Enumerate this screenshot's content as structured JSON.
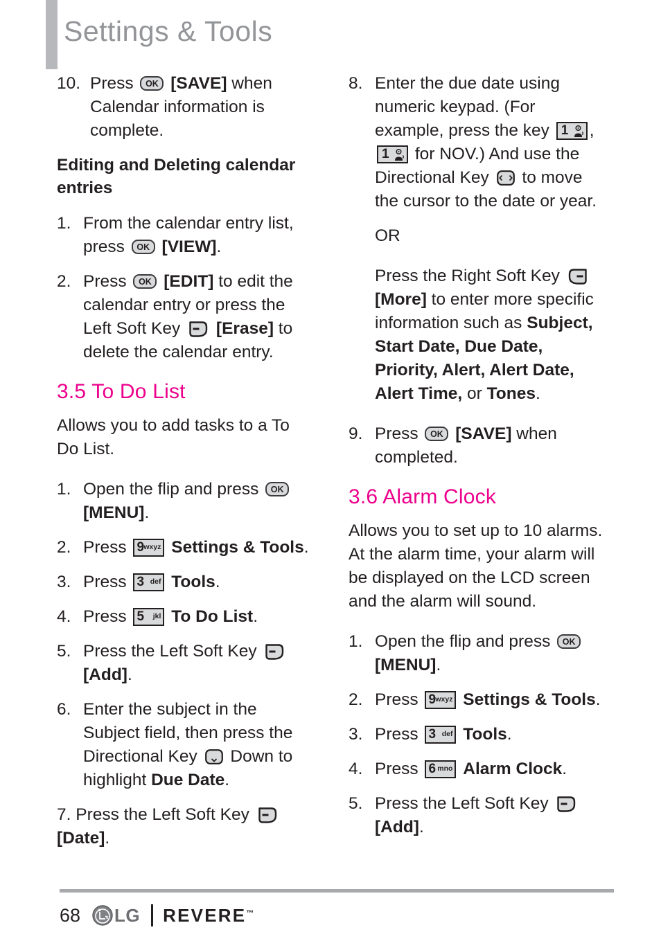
{
  "header": {
    "title": "Settings & Tools"
  },
  "left_column": {
    "step10": {
      "num": "10.",
      "t1": "Press",
      "icon": "ok-key-icon",
      "t2": "[SAVE]",
      "t3": "when Calendar information is complete."
    },
    "subhead_editing": "Editing and Deleting calendar entries",
    "step1": {
      "num": "1.",
      "t1": "From the calendar entry list, press",
      "icon": "ok-key-icon",
      "t2": "[VIEW]",
      "t3": "."
    },
    "step2": {
      "num": "2.",
      "t1": "Press",
      "icon1": "ok-key-icon",
      "t2": "[EDIT]",
      "t3": "to edit the calendar entry or press the Left Soft Key",
      "icon2": "left-soft-key-icon",
      "t4": "[Erase]",
      "t5": "to delete the calendar entry."
    },
    "section_35": "3.5 To Do List",
    "intro_35": "Allows you to add tasks to a To Do List.",
    "steps": [
      {
        "num": "1.",
        "t1": "Open the flip and press",
        "icon": "ok-key-icon",
        "t2": "[MENU]",
        "t3": "."
      },
      {
        "num": "2.",
        "t1": "Press",
        "key_digit": "9",
        "key_letters": "wxyz",
        "t2": "Settings & Tools",
        "t3": "."
      },
      {
        "num": "3.",
        "t1": "Press",
        "key_digit": "3",
        "key_letters": "def",
        "t2": "Tools",
        "t3": "."
      },
      {
        "num": "4.",
        "t1": "Press",
        "key_digit": "5",
        "key_letters": "jkl",
        "t2": "To Do List",
        "t3": "."
      },
      {
        "num": "5.",
        "t1": "Press the Left Soft Key",
        "icon": "left-soft-key-icon",
        "t2": "[Add]",
        "t3": "."
      },
      {
        "num": "6.",
        "t1": "Enter the subject in the Subject field, then press the Directional Key",
        "icon": "directional-key-down-icon",
        "t2": "Down to highlight",
        "t3": "Due Date",
        "t4": "."
      },
      {
        "num": "7.",
        "t1": "Press the Left Soft Key",
        "icon": "left-soft-key-icon",
        "t2": "[Date]",
        "t3": "."
      }
    ]
  },
  "right_column": {
    "step8": {
      "num": "8.",
      "t1": "Enter the due date using numeric keypad. (For example, press the key",
      "key1_digit": "1",
      "sep": ",",
      "key2_digit": "1",
      "t2": "for NOV.) And use the Directional Key",
      "icon": "directional-key-left-right-icon",
      "t3": "to move the cursor to the date or year."
    },
    "or_text": "OR",
    "more_block": {
      "t1": "Press the Right Soft Key",
      "icon": "right-soft-key-icon",
      "t2": "[More]",
      "t3": "to enter more specific information such as",
      "t4": "Subject, Start Date, Due Date, Priority, Alert, Alert Date, Alert Time,",
      "t5": "or",
      "t6": "Tones",
      "t7": "."
    },
    "step9": {
      "num": "9.",
      "t1": "Press",
      "icon": "ok-key-icon",
      "t2": "[SAVE]",
      "t3": "when completed."
    },
    "section_36": "3.6 Alarm Clock",
    "intro_36": "Allows you to set up to 10 alarms. At the alarm time, your alarm will be displayed on the LCD screen and the alarm will sound.",
    "steps": [
      {
        "num": "1.",
        "t1": "Open the flip and press",
        "icon": "ok-key-icon",
        "t2": "[MENU]",
        "t3": "."
      },
      {
        "num": "2.",
        "t1": "Press",
        "key_digit": "9",
        "key_letters": "wxyz",
        "t2": "Settings & Tools",
        "t3": "."
      },
      {
        "num": "3.",
        "t1": "Press",
        "key_digit": "3",
        "key_letters": "def",
        "t2": "Tools",
        "t3": "."
      },
      {
        "num": "4.",
        "t1": "Press",
        "key_digit": "6",
        "key_letters": "mno",
        "t2": "Alarm Clock",
        "t3": "."
      },
      {
        "num": "5.",
        "t1": "Press the Left Soft Key",
        "icon": "left-soft-key-icon",
        "t2": "[Add]",
        "t3": "."
      }
    ]
  },
  "footer": {
    "page_number": "68",
    "brand": "LG",
    "model": "REVERE",
    "trademark": "™"
  },
  "colors": {
    "accent_pink": "#ec008c",
    "header_gray": "#939598",
    "bar_gray": "#b6b8bb",
    "rule_gray": "#a7a9ac",
    "text": "#231f20"
  }
}
